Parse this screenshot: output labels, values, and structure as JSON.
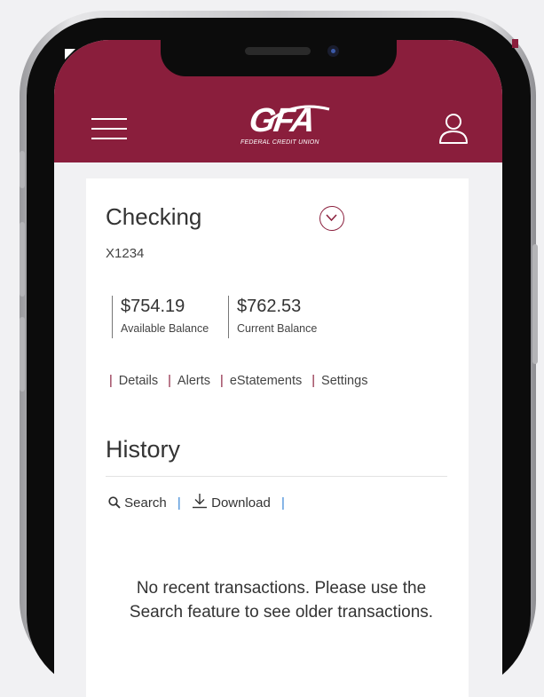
{
  "header": {
    "logo_text": "GFA",
    "logo_subtext": "FEDERAL CREDIT UNION",
    "brand_color": "#8a1e3c"
  },
  "account": {
    "name": "Checking",
    "number": "X1234",
    "available_balance": "$754.19",
    "available_label": "Available Balance",
    "current_balance": "$762.53",
    "current_label": "Current Balance"
  },
  "account_links": [
    "Details",
    "Alerts",
    "eStatements",
    "Settings"
  ],
  "history": {
    "title": "History",
    "search_label": "Search",
    "download_label": "Download",
    "empty_message": "No recent transactions. Please use the Search feature to see older transactions."
  },
  "icons": {
    "menu": "hamburger-menu-icon",
    "profile": "user-profile-icon",
    "toggle": "chevron-down-circle-icon",
    "search": "search-icon",
    "download": "download-icon"
  }
}
